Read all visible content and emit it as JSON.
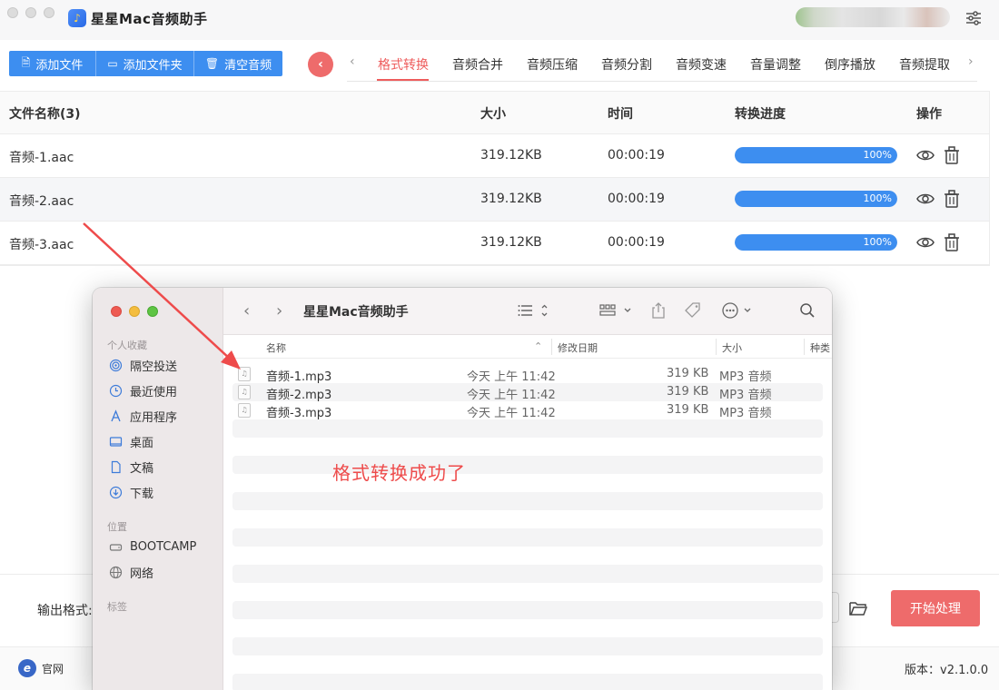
{
  "app": {
    "title": "星星Mac音频助手",
    "icon_glyph": "♪"
  },
  "toolbar": {
    "add_file": "添加文件",
    "add_folder": "添加文件夹",
    "clear_audio": "清空音频"
  },
  "tabs": [
    {
      "label": "格式转换",
      "active": true
    },
    {
      "label": "音频合并",
      "active": false
    },
    {
      "label": "音频压缩",
      "active": false
    },
    {
      "label": "音频分割",
      "active": false
    },
    {
      "label": "音频变速",
      "active": false
    },
    {
      "label": "音量调整",
      "active": false
    },
    {
      "label": "倒序播放",
      "active": false
    },
    {
      "label": "音频提取",
      "active": false
    }
  ],
  "table": {
    "headers": {
      "name": "文件名称(3)",
      "size": "大小",
      "time": "时间",
      "progress": "转换进度",
      "actions": "操作"
    },
    "rows": [
      {
        "name": "音频-1.aac",
        "size": "319.12KB",
        "time": "00:00:19",
        "progress": 1.0,
        "progress_label": "100%"
      },
      {
        "name": "音频-2.aac",
        "size": "319.12KB",
        "time": "00:00:19",
        "progress": 1.0,
        "progress_label": "100%"
      },
      {
        "name": "音频-3.aac",
        "size": "319.12KB",
        "time": "00:00:19",
        "progress": 1.0,
        "progress_label": "100%"
      }
    ]
  },
  "bottom": {
    "output_format_label": "输出格式:",
    "start_button": "开始处理",
    "site_label": "官网",
    "version": "版本：v2.1.0.0"
  },
  "finder": {
    "title": "星星Mac音频助手",
    "sidebar": {
      "favorites_title": "个人收藏",
      "favorites": [
        {
          "label": "隔空投送",
          "icon": "airdrop-icon"
        },
        {
          "label": "最近使用",
          "icon": "clock-icon"
        },
        {
          "label": "应用程序",
          "icon": "applications-icon"
        },
        {
          "label": "桌面",
          "icon": "desktop-icon"
        },
        {
          "label": "文稿",
          "icon": "document-icon"
        },
        {
          "label": "下载",
          "icon": "download-icon"
        }
      ],
      "locations_title": "位置",
      "locations": [
        {
          "label": "BOOTCAMP",
          "icon": "drive-icon"
        },
        {
          "label": "网络",
          "icon": "network-icon"
        }
      ],
      "tags_title": "标签"
    },
    "columns": {
      "name": "名称",
      "modified": "修改日期",
      "size": "大小",
      "kind": "种类"
    },
    "files": [
      {
        "name": "音频-1.mp3",
        "modified": "今天 上午 11:42",
        "size": "319 KB",
        "kind": "MP3 音频"
      },
      {
        "name": "音频-2.mp3",
        "modified": "今天 上午 11:42",
        "size": "319 KB",
        "kind": "MP3 音频"
      },
      {
        "name": "音频-3.mp3",
        "modified": "今天 上午 11:42",
        "size": "319 KB",
        "kind": "MP3 音频"
      }
    ]
  },
  "annotation": {
    "text": "格式转换成功了",
    "color": "#ee4b4b"
  },
  "colors": {
    "accent_blue": "#3d8ef0",
    "accent_red": "#ee6b6b"
  }
}
